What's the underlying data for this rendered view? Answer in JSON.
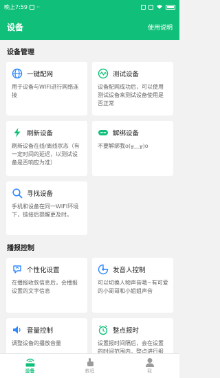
{
  "status_bar": {
    "time": "晚上7:59",
    "dots": "··"
  },
  "app_bar": {
    "title": "设备",
    "help_link": "使用说明"
  },
  "sections": [
    {
      "title": "设备管理",
      "cards": [
        {
          "icon": "globe-icon",
          "title": "一键配网",
          "desc": "用于设备与WIFI进行网络连接"
        },
        {
          "icon": "wave-test-icon",
          "title": "测试设备",
          "desc": "设备配网成功后，可以使用测试设备来测试设备使用是否正常"
        },
        {
          "icon": "bolt-refresh-icon",
          "title": "刷新设备",
          "desc": "刷新设备在线/离线状态（有一定时间的延迟，以测试设备是否响应为准）"
        },
        {
          "icon": "unbind-icon",
          "title": "解绑设备",
          "desc": "不要解绑我o(╥﹏╥)o"
        },
        {
          "icon": "search-icon",
          "title": "寻找设备",
          "desc": "手机和设备在同一WIFI环境下，链接后提醒更及时。"
        }
      ]
    },
    {
      "title": "播报控制",
      "cards": [
        {
          "icon": "personalize-icon",
          "title": "个性化设置",
          "desc": "在播报收款信息后，会播报设置的文字信息"
        },
        {
          "icon": "speaker-voice-icon",
          "title": "发音人控制",
          "desc": "可以切换人物声音哦~有可爱的小哥哥和小姐姐声音"
        },
        {
          "icon": "volume-icon",
          "title": "音量控制",
          "desc": "调整设备的播放音量"
        },
        {
          "icon": "alarm-clock-icon",
          "title": "整点报时",
          "desc": "设置报时间隔后，会在设置的时间范围内，整点进行报时"
        }
      ]
    }
  ],
  "bottom_nav": [
    {
      "icon": "device-router-icon",
      "label": "设备",
      "active": true
    },
    {
      "icon": "tutorial-hand-icon",
      "label": "教程",
      "active": false
    },
    {
      "icon": "user-icon",
      "label": "我",
      "active": false
    }
  ],
  "colors": {
    "accent": "#10c07a",
    "background": "#f2f2f2",
    "card": "#ffffff"
  }
}
